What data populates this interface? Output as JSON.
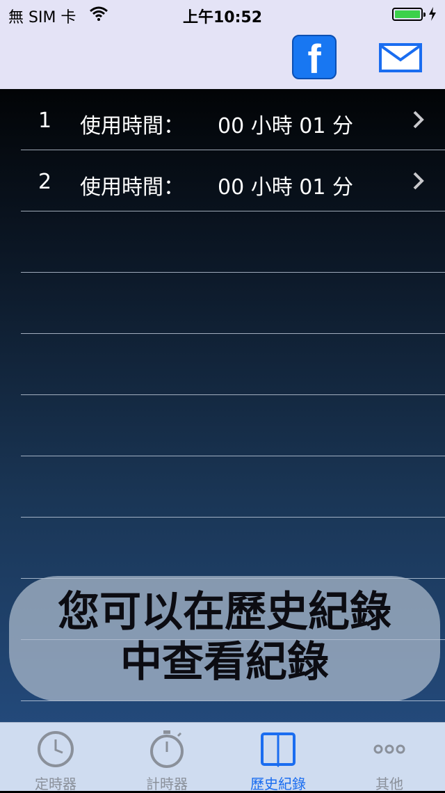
{
  "status_bar": {
    "carrier": "無 SIM 卡",
    "time": "上午10:52",
    "battery_level": 1.0
  },
  "nav": {
    "facebook_glyph": "f",
    "icons": [
      "facebook-icon",
      "mail-icon"
    ]
  },
  "list": {
    "rows": [
      {
        "index": "1",
        "label": "使用時間：",
        "duration": "00 小時 01 分"
      },
      {
        "index": "2",
        "label": "使用時間：",
        "duration": "00 小時 01 分"
      }
    ]
  },
  "hint": {
    "line1": "您可以在歷史紀錄",
    "line2": "中查看紀錄"
  },
  "tabbar": {
    "tabs": [
      {
        "label": "定時器",
        "icon": "clock-icon"
      },
      {
        "label": "計時器",
        "icon": "stopwatch-icon"
      },
      {
        "label": "歷史紀錄",
        "icon": "book-icon"
      },
      {
        "label": "其他",
        "icon": "more-icon"
      }
    ],
    "active_index": 2
  },
  "colors": {
    "accent": "#1a6df0",
    "facebook": "#1877f2",
    "battery": "#3bd14a",
    "topbar": "#e4e3f6",
    "tabbar": "#cfdcf0"
  }
}
